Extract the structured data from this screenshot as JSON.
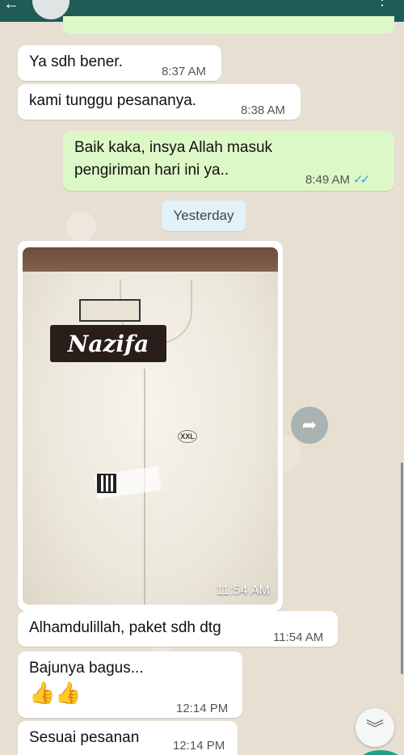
{
  "topbar": {
    "back_icon": "back-arrow-icon",
    "avatar_icon": "avatar-icon"
  },
  "messages": [
    {
      "text": "Ya   sdh bener.",
      "time": "8:37 AM",
      "direction": "in"
    },
    {
      "text": "kami tunggu pesananya.",
      "time": "8:38 AM",
      "direction": "in"
    },
    {
      "text_line1": "Baik kaka, insya Allah masuk",
      "text_line2": "pengiriman hari ini ya..",
      "time": "8:49 AM",
      "direction": "out",
      "status": "read"
    },
    {
      "text": "Alhamdulillah, paket sdh dtg",
      "time": "11:54 AM",
      "direction": "in"
    },
    {
      "text": "Bajunya bagus...",
      "emoji": "👍👍",
      "time": "12:14 PM",
      "direction": "in"
    },
    {
      "text": "Sesuai pesanan",
      "time": "12:14 PM",
      "direction": "in"
    }
  ],
  "date_separator": "Yesterday",
  "photo_message": {
    "time": "11:54 AM",
    "brand_text": "Nazifa",
    "size_text": "XXL"
  },
  "colors": {
    "incoming_bubble": "#ffffff",
    "outgoing_bubble": "#dcf8c6",
    "header": "#1f5c55",
    "read_ticks": "#3a9be0"
  },
  "icons": {
    "forward": "forward-share-icon",
    "scroll_down": "double-chevron-down-icon",
    "read_ticks": "double-check-icon"
  }
}
